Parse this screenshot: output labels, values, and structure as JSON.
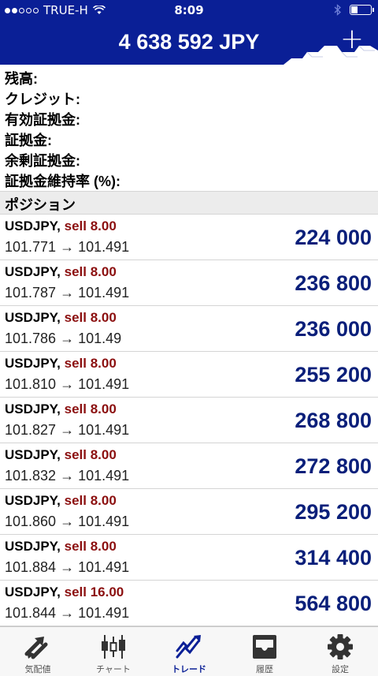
{
  "status_bar": {
    "carrier": "TRUE-H",
    "time": "8:09"
  },
  "header": {
    "equity": "4 638 592 JPY",
    "add_icon": "plus-icon"
  },
  "summary": {
    "labels": [
      "残高:",
      "クレジット:",
      "有効証拠金:",
      "証拠金:",
      "余剰証拠金:",
      "証拠金維持率 (%):"
    ]
  },
  "positions_section": {
    "title": "ポジション"
  },
  "positions": [
    {
      "symbol": "USDJPY,",
      "side": "sell 8.00",
      "prices": "101.771 → 101.491",
      "profit": "224 000"
    },
    {
      "symbol": "USDJPY,",
      "side": "sell 8.00",
      "prices": "101.787 → 101.491",
      "profit": "236 800"
    },
    {
      "symbol": "USDJPY,",
      "side": "sell 8.00",
      "prices": "101.786 → 101.49",
      "profit": "236 000"
    },
    {
      "symbol": "USDJPY,",
      "side": "sell 8.00",
      "prices": "101.810 → 101.491",
      "profit": "255 200"
    },
    {
      "symbol": "USDJPY,",
      "side": "sell 8.00",
      "prices": "101.827 → 101.491",
      "profit": "268 800"
    },
    {
      "symbol": "USDJPY,",
      "side": "sell 8.00",
      "prices": "101.832 → 101.491",
      "profit": "272 800"
    },
    {
      "symbol": "USDJPY,",
      "side": "sell 8.00",
      "prices": "101.860 → 101.491",
      "profit": "295 200"
    },
    {
      "symbol": "USDJPY,",
      "side": "sell 8.00",
      "prices": "101.884 → 101.491",
      "profit": "314 400"
    },
    {
      "symbol": "USDJPY,",
      "side": "sell 16.00",
      "prices": "101.844 → 101.491",
      "profit": "564 800"
    }
  ],
  "tabs": [
    {
      "label": "気配値",
      "icon": "quotes-icon"
    },
    {
      "label": "チャート",
      "icon": "chart-icon"
    },
    {
      "label": "トレード",
      "icon": "trade-icon",
      "active": true
    },
    {
      "label": "履歴",
      "icon": "history-icon"
    },
    {
      "label": "設定",
      "icon": "settings-icon"
    }
  ],
  "colors": {
    "brand": "#0a1f96",
    "sell": "#8b0f0f",
    "profit": "#0a1f7a"
  }
}
